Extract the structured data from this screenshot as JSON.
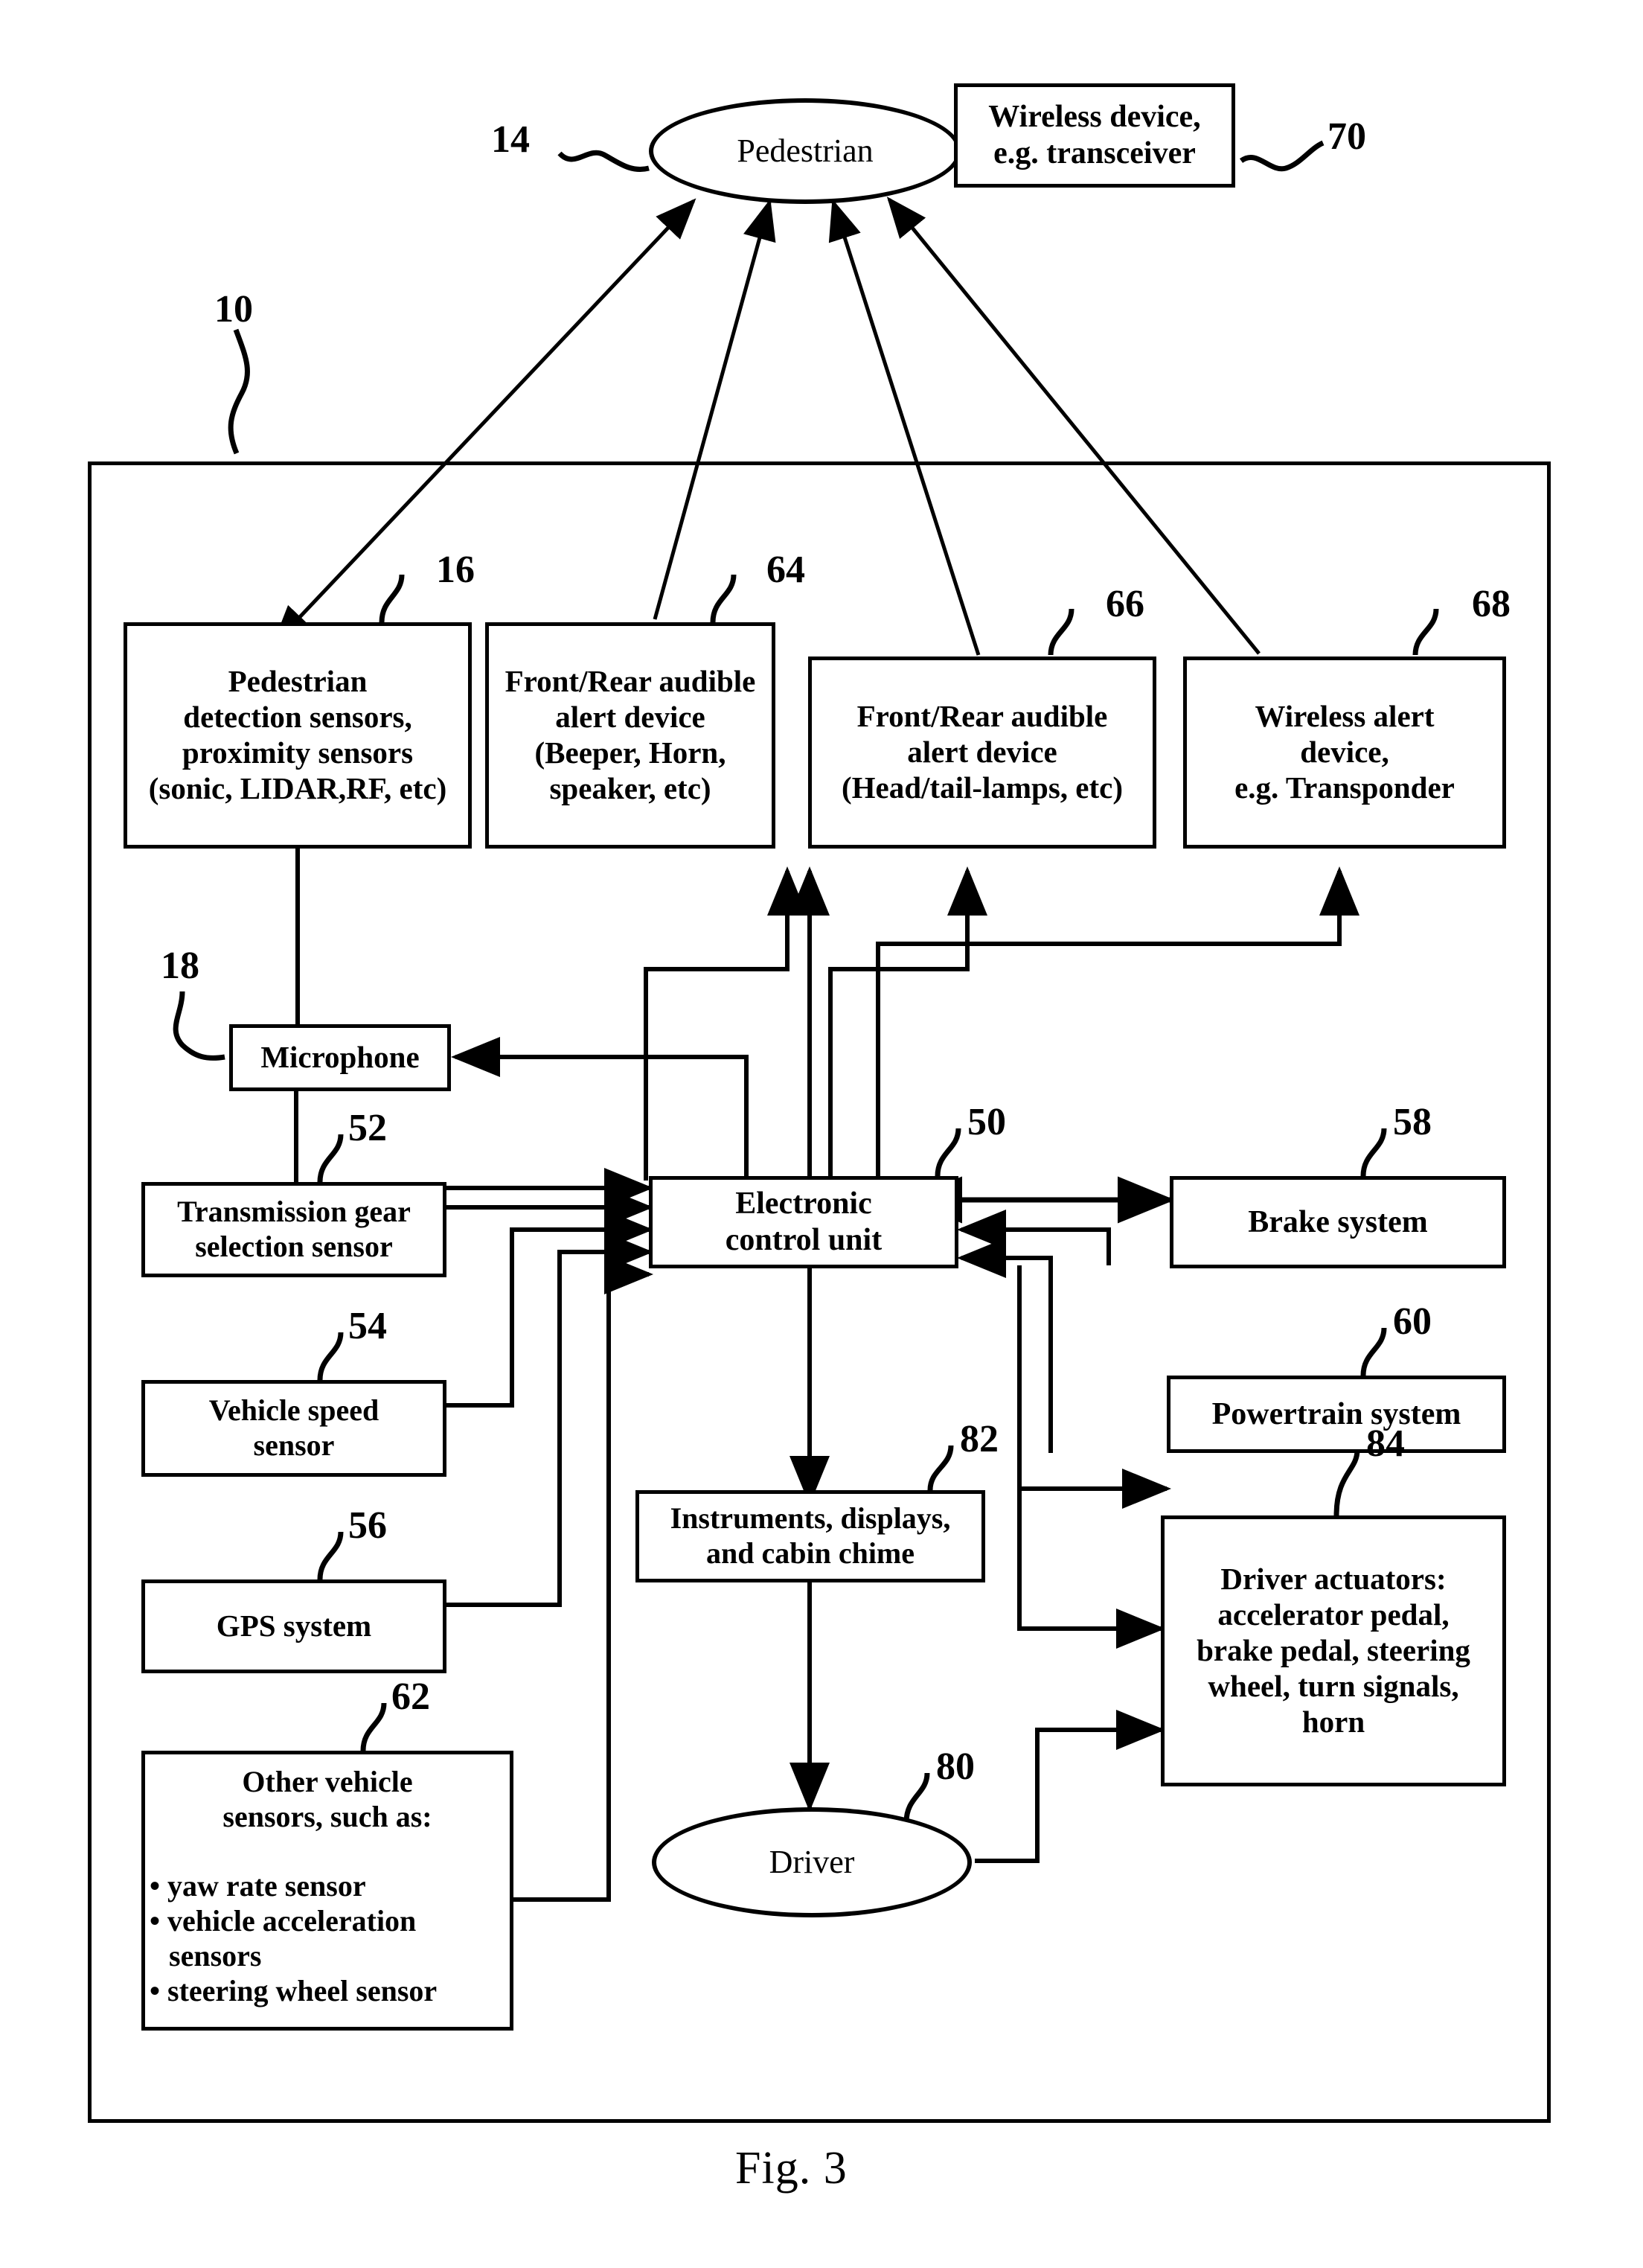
{
  "figure": {
    "caption": "Fig. 3",
    "system_ref": "10"
  },
  "nodes": {
    "pedestrian": {
      "label": "Pedestrian",
      "ref": "14",
      "shape": "ellipse"
    },
    "wireless_device": {
      "line1": "Wireless device,",
      "line2": "e.g. transceiver",
      "ref": "70",
      "shape": "box"
    },
    "pedestrian_sensors": {
      "line1": "Pedestrian",
      "line2": "detection sensors,",
      "line3": "proximity sensors",
      "line4": "(sonic, LIDAR,RF, etc)",
      "ref": "16",
      "shape": "box"
    },
    "audible_alert": {
      "line1": "Front/Rear audible",
      "line2": "alert device",
      "line3": "(Beeper, Horn,",
      "line4": "speaker, etc)",
      "ref": "64",
      "shape": "box"
    },
    "visual_alert": {
      "line1": "Front/Rear audible",
      "line2": "alert device",
      "line3": "(Head/tail-lamps, etc)",
      "ref": "66",
      "shape": "box"
    },
    "wireless_alert": {
      "line1": "Wireless alert",
      "line2": "device,",
      "line3": "e.g. Transponder",
      "ref": "68",
      "shape": "box"
    },
    "microphone": {
      "label": "Microphone",
      "ref": "18",
      "shape": "box"
    },
    "transmission_sensor": {
      "line1": "Transmission gear",
      "line2": "selection sensor",
      "ref": "52",
      "shape": "box"
    },
    "speed_sensor": {
      "line1": "Vehicle speed",
      "line2": "sensor",
      "ref": "54",
      "shape": "box"
    },
    "gps_system": {
      "label": "GPS system",
      "ref": "56",
      "shape": "box"
    },
    "other_sensors": {
      "heading": "Other vehicle",
      "heading2": "sensors, such as:",
      "bullets": [
        "• yaw rate sensor",
        "• vehicle acceleration",
        "sensors",
        "• steering wheel sensor"
      ],
      "ref": "62",
      "shape": "box"
    },
    "ecu": {
      "line1": "Electronic",
      "line2": "control unit",
      "ref": "50",
      "shape": "box"
    },
    "brake_system": {
      "label": "Brake system",
      "ref": "58",
      "shape": "box"
    },
    "powertrain_system": {
      "label": "Powertrain system",
      "ref": "60",
      "shape": "box"
    },
    "instruments": {
      "line1": "Instruments, displays,",
      "line2": "and cabin chime",
      "ref": "82",
      "shape": "box"
    },
    "driver_actuators": {
      "line1": "Driver actuators:",
      "line2": "accelerator pedal,",
      "line3": "brake pedal, steering",
      "line4": "wheel, turn signals,",
      "line5": "horn",
      "ref": "84",
      "shape": "box"
    },
    "driver": {
      "label": "Driver",
      "ref": "80",
      "shape": "ellipse"
    }
  },
  "colors": {
    "stroke": "#000000",
    "background": "#ffffff"
  }
}
